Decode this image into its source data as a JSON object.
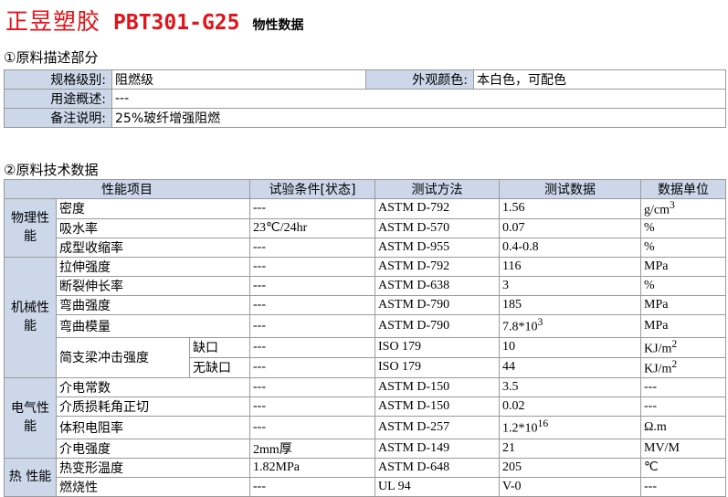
{
  "header": {
    "company": "正昱塑胶",
    "model": "PBT301-G25",
    "subtitle": "物性数据"
  },
  "section1": {
    "title": "①原料描述部分",
    "rows": [
      {
        "label": "规格级别:",
        "value": "阻燃级",
        "label2": "外观颜色:",
        "value2": "本白色，可配色"
      },
      {
        "label": "用途概述:",
        "value": "---"
      },
      {
        "label": "备注说明:",
        "value": "25%玻纤增强阻燃"
      }
    ]
  },
  "section2": {
    "title": "②原料技术数据",
    "headers": [
      "性能项目",
      "试验条件[状态]",
      "测试方法",
      "测试数据",
      "数据单位"
    ],
    "groups": [
      {
        "category": "物理性能",
        "rows": [
          {
            "prop": "密度",
            "cond": "---",
            "method": "ASTM D-792",
            "data": "1.56",
            "unit": "g/cm",
            "unit_sup": "3"
          },
          {
            "prop": "吸水率",
            "cond": "23℃/24hr",
            "method": "ASTM D-570",
            "data": "0.07",
            "unit": "%"
          },
          {
            "prop": "成型收缩率",
            "cond": "---",
            "method": "ASTM D-955",
            "data": "0.4-0.8",
            "unit": "%"
          }
        ]
      },
      {
        "category": "机械性能",
        "rows": [
          {
            "prop": "拉伸强度",
            "cond": "---",
            "method": "ASTM D-792",
            "data": "116",
            "unit": "MPa"
          },
          {
            "prop": "断裂伸长率",
            "cond": "---",
            "method": "ASTM D-638",
            "data": "3",
            "unit": "%"
          },
          {
            "prop": "弯曲强度",
            "cond": "---",
            "method": "ASTM D-790",
            "data": "185",
            "unit": "MPa"
          },
          {
            "prop": "弯曲模量",
            "cond": "---",
            "method": "ASTM D-790",
            "data": "7.8*10",
            "data_sup": "3",
            "unit": "MPa"
          }
        ],
        "impact": {
          "prop": "简支梁冲击强度",
          "rows": [
            {
              "sub": "缺口",
              "cond": "---",
              "method": "ISO 179",
              "data": "10",
              "unit": "KJ/m",
              "unit_sup": "2"
            },
            {
              "sub": "无缺口",
              "cond": "---",
              "method": "ISO 179",
              "data": "44",
              "unit": "KJ/m",
              "unit_sup": "2"
            }
          ]
        }
      },
      {
        "category": "电气性能",
        "rows": [
          {
            "prop": "介电常数",
            "cond": "---",
            "method": "ASTM D-150",
            "data": "3.5",
            "unit": "---"
          },
          {
            "prop": "介质损耗角正切",
            "cond": "---",
            "method": "ASTM D-150",
            "data": "0.02",
            "unit": "---"
          },
          {
            "prop": "体积电阻率",
            "cond": "---",
            "method": "ASTM D-257",
            "data": "1.2*10",
            "data_sup": "16",
            "unit": "Ω.m"
          },
          {
            "prop": "介电强度",
            "cond": "2mm厚",
            "method": "ASTM D-149",
            "data": "21",
            "unit": "MV/M"
          }
        ]
      },
      {
        "category": "热 性能",
        "rows": [
          {
            "prop": "热变形温度",
            "cond": "1.82MPa",
            "method": "ASTM D-648",
            "data": "205",
            "unit": "℃"
          },
          {
            "prop": "燃烧性",
            "cond": "---",
            "method": "UL 94",
            "data": "V-0",
            "unit": "---"
          }
        ]
      }
    ]
  }
}
